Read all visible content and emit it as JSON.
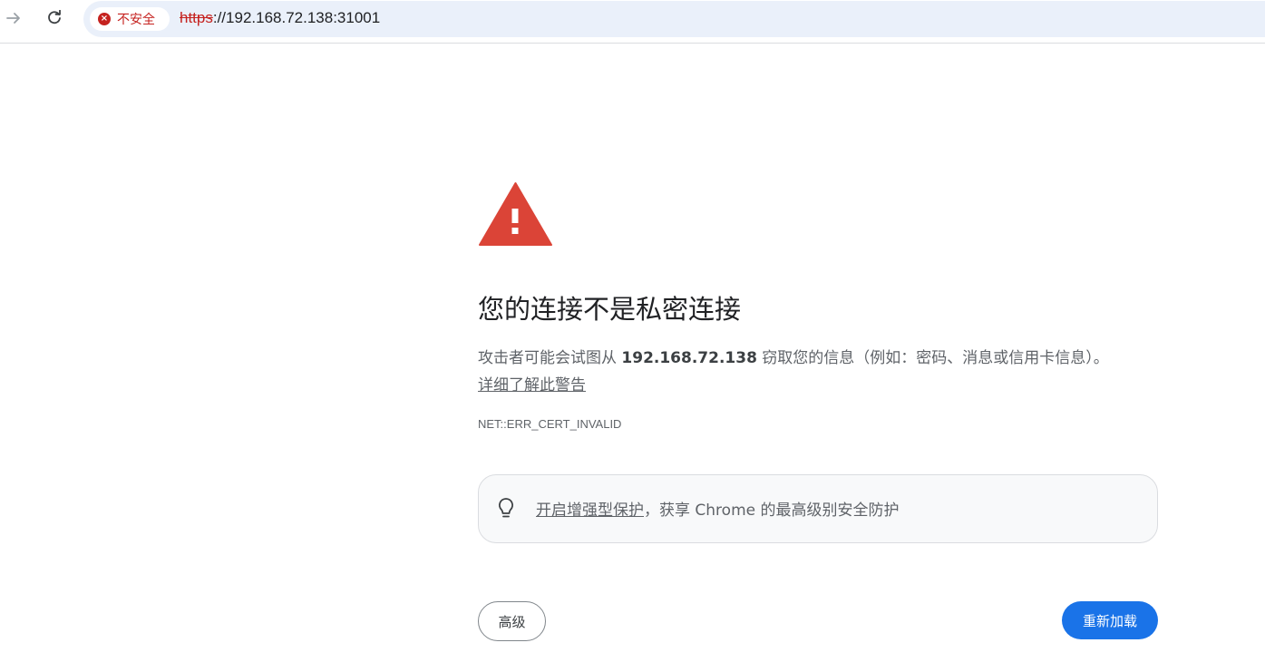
{
  "browser": {
    "security_label": "不安全",
    "url_scheme": "https",
    "url_rest": "://192.168.72.138:31001"
  },
  "interstitial": {
    "heading": "您的连接不是私密连接",
    "body_prefix": "攻击者可能会试图从 ",
    "body_host": "192.168.72.138",
    "body_suffix": " 窃取您的信息（例如：密码、消息或信用卡信息）。",
    "learn_more": "详细了解此警告",
    "error_code": "NET::ERR_CERT_INVALID",
    "protection_link": "开启增强型保护",
    "protection_suffix": "，获享 Chrome 的最高级别安全防护",
    "advanced_button": "高级",
    "reload_button": "重新加载"
  },
  "colors": {
    "danger": "#c5221f",
    "warning_triangle": "#db4437",
    "primary_button": "#1a73e8"
  },
  "icons": {
    "forward": "arrow-forward-icon",
    "reload": "reload-icon",
    "security": "not-secure-icon",
    "warning": "warning-triangle-icon",
    "bulb": "lightbulb-icon"
  }
}
